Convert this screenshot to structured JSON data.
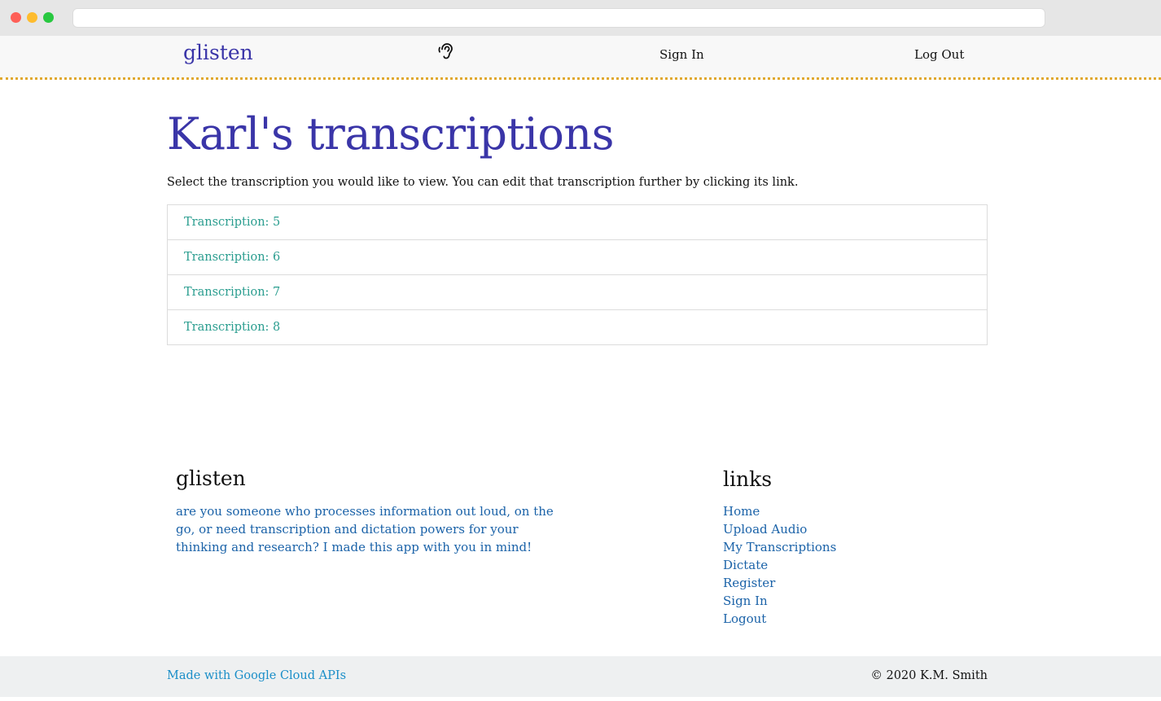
{
  "browser": {
    "url": ""
  },
  "navbar": {
    "brand": "glisten",
    "icon": "ear-icon",
    "links": [
      "Sign In",
      "Log Out"
    ],
    "border_color": "#e0a82e"
  },
  "main": {
    "title": "Karl's transcriptions",
    "intro": "Select the transcription you would like to view. You can edit that transcription further by clicking its link.",
    "transcriptions": [
      "Transcription: 5",
      "Transcription: 6",
      "Transcription: 7",
      "Transcription: 8"
    ]
  },
  "footer": {
    "brand_title": "glisten",
    "description": "are you someone who processes information out loud, on the go, or need transcription and dictation powers for your thinking and research? I made this app with you in mind!",
    "links_title": "links",
    "links": [
      "Home",
      "Upload Audio",
      "My Transcriptions",
      "Dictate",
      "Register",
      "Sign In",
      "Logout"
    ],
    "made_with": "Made with Google Cloud APIs",
    "copyright": "© 2020 K.M. Smith"
  },
  "colors": {
    "brand": "#3a35a8",
    "transcription_link": "#2a9d8f",
    "footer_link": "#1a62a8"
  }
}
